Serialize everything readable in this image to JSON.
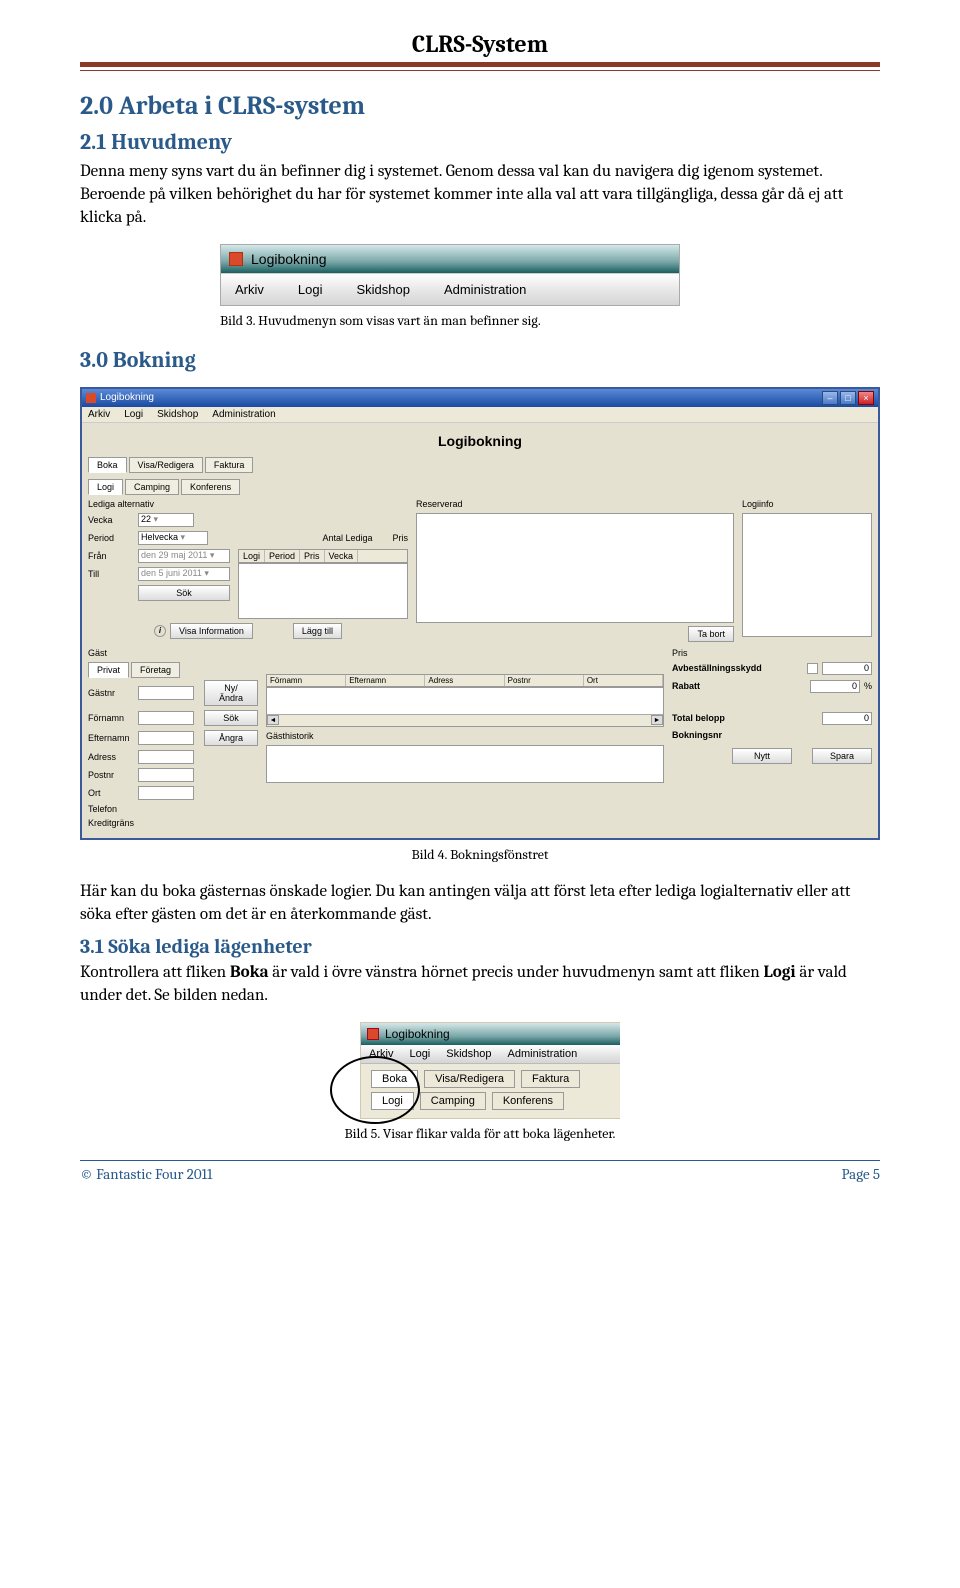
{
  "header": {
    "title": "CLRS-System"
  },
  "s2_0": {
    "title": "2.0 Arbeta i CLRS-system"
  },
  "s2_1": {
    "title": "2.1 Huvudmeny",
    "p1": "Denna meny syns vart du än befinner dig i systemet. Genom dessa val kan du navigera dig igenom systemet. Beroende på vilken behörighet du har för systemet kommer inte alla val att vara tillgängliga, dessa går då ej att klicka på."
  },
  "fig3": {
    "window_title": "Logibokning",
    "menu": [
      "Arkiv",
      "Logi",
      "Skidshop",
      "Administration"
    ],
    "caption": "Bild 3. Huvudmenyn som visas vart än man befinner sig."
  },
  "s3_0": {
    "title": "3.0 Bokning"
  },
  "fig4": {
    "window_title": "Logibokning",
    "menu": [
      "Arkiv",
      "Logi",
      "Skidshop",
      "Administration"
    ],
    "heading": "Logibokning",
    "tabs1": [
      "Boka",
      "Visa/Redigera",
      "Faktura"
    ],
    "tabs2": [
      "Logi",
      "Camping",
      "Konferens"
    ],
    "lediga_label": "Lediga alternativ",
    "reserverad_label": "Reserverad",
    "logiinfo_label": "Logiinfo",
    "vecka_label": "Vecka",
    "vecka_val": "22",
    "period_label": "Period",
    "period_val": "Helvecka",
    "antal_label": "Antal Lediga",
    "pris_label_h": "Pris",
    "fran_label": "Från",
    "fran_val": "den 29    maj    2011",
    "till_label": "Till",
    "till_val": "den  5    juni   2011",
    "sok_btn": "Sök",
    "list_headers": [
      "Logi",
      "Period",
      "Pris",
      "Vecka"
    ],
    "visa_info_btn": "Visa Information",
    "lagg_till_btn": "Lägg till",
    "ta_bort_btn": "Ta bort",
    "gast_label": "Gäst",
    "gast_tabs": [
      "Privat",
      "Företag"
    ],
    "gast_fields": [
      "Gästnr",
      "Förnamn",
      "Efternamn",
      "Adress",
      "Postnr",
      "Ort",
      "Telefon",
      "Kreditgräns"
    ],
    "ny_andra_btn": "Ny/Ändra",
    "sok_btn2": "Sök",
    "angra_btn": "Ångra",
    "grid_headers": [
      "Förnamn",
      "Efternamn",
      "Adress",
      "Postnr",
      "Ort"
    ],
    "gasthistorik_label": "Gästhistorik",
    "pris_label": "Pris",
    "avbest_label": "Avbeställningsskydd",
    "avbest_val": "0",
    "rabatt_label": "Rabatt",
    "rabatt_val": "0",
    "rabatt_unit": "%",
    "total_label": "Total belopp",
    "total_val": "0",
    "bokningsnr_label": "Bokningsnr",
    "nytt_btn": "Nytt",
    "spara_btn": "Spara",
    "caption": "Bild 4. Bokningsfönstret"
  },
  "p_after_fig4": {
    "t1": "Här kan du boka gästernas önskade logier. Du kan antingen välja att först leta efter lediga logialternativ eller att söka efter gästen om det är en återkommande gäst."
  },
  "s3_1": {
    "title": "3.1 Söka lediga lägenheter",
    "t1a": "Kontrollera att fliken ",
    "t1b": "Boka",
    "t1c": " är vald i övre vänstra hörnet precis under huvudmenyn samt att fliken ",
    "t1d": "Logi",
    "t1e": " är vald under det. Se bilden nedan."
  },
  "fig5": {
    "window_title": "Logibokning",
    "menu": [
      "Arkiv",
      "Logi",
      "Skidshop",
      "Administration"
    ],
    "tabs1": [
      "Boka",
      "Visa/Redigera",
      "Faktura"
    ],
    "tabs2": [
      "Logi",
      "Camping",
      "Konferens"
    ],
    "caption": "Bild 5. Visar flikar valda för att boka lägenheter."
  },
  "footer": {
    "left": "© Fantastic Four 2011",
    "right": "Page 5"
  }
}
